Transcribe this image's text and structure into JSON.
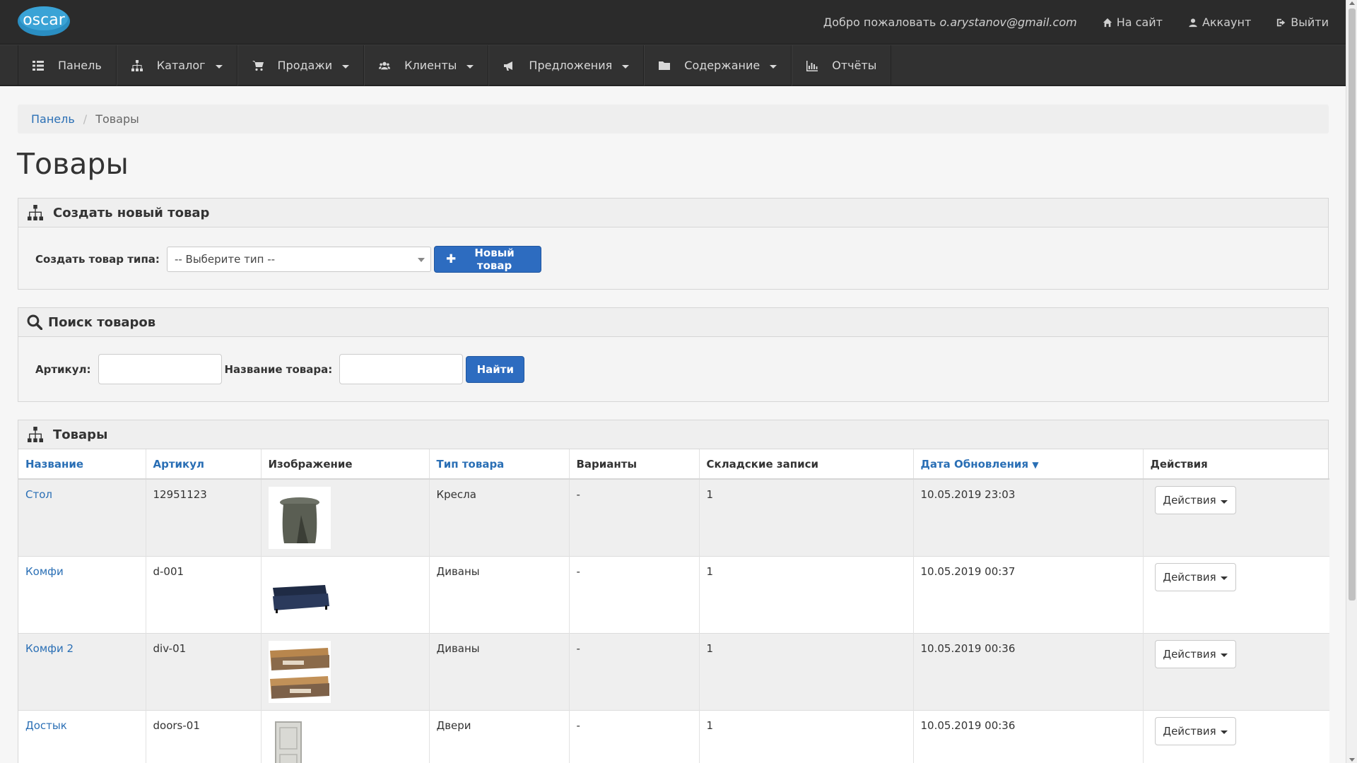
{
  "header": {
    "logo_text": "oscar",
    "welcome_prefix": "Добро пожаловать",
    "user_email": "o.arystanov@gmail.com",
    "site_link": "На сайт",
    "account_link": "Аккаунт",
    "logout_link": "Выйти"
  },
  "nav": {
    "items": [
      {
        "label": "Панель",
        "icon": "dashboard-icon"
      },
      {
        "label": "Каталог",
        "icon": "sitemap-icon"
      },
      {
        "label": "Продажи",
        "icon": "cart-icon"
      },
      {
        "label": "Клиенты",
        "icon": "users-icon"
      },
      {
        "label": "Предложения",
        "icon": "bullhorn-icon"
      },
      {
        "label": "Содержание",
        "icon": "folder-icon"
      },
      {
        "label": "Отчёты",
        "icon": "bar-chart-icon"
      }
    ]
  },
  "breadcrumb": {
    "home": "Панель",
    "current": "Товары"
  },
  "page_title": "Товары",
  "create_panel": {
    "title": "Создать новый товар",
    "label": "Создать товар типа:",
    "select_value": "-- Выберите тип --",
    "button": "Новый товар"
  },
  "search_panel": {
    "title": "Поиск товаров",
    "sku_label": "Артикул:",
    "name_label": "Название товара:",
    "button": "Найти"
  },
  "products_panel": {
    "title": "Товары",
    "columns": [
      "Название",
      "Артикул",
      "Изображение",
      "Тип товара",
      "Варианты",
      "Складские записи",
      "Дата Обновления",
      "Действия"
    ],
    "rows": [
      {
        "name": "Стол",
        "sku": "12951123",
        "type": "Кресла",
        "variants": "-",
        "stock": "1",
        "updated": "10.05.2019 23:03",
        "action": "Действия"
      },
      {
        "name": "Комфи",
        "sku": "d-001",
        "type": "Диваны",
        "variants": "-",
        "stock": "1",
        "updated": "10.05.2019 00:37",
        "action": "Действия"
      },
      {
        "name": "Комфи 2",
        "sku": "div-01",
        "type": "Диваны",
        "variants": "-",
        "stock": "1",
        "updated": "10.05.2019 00:36",
        "action": "Действия"
      },
      {
        "name": "Достык",
        "sku": "doors-01",
        "type": "Двери",
        "variants": "-",
        "stock": "1",
        "updated": "10.05.2019 00:36",
        "action": "Действия"
      }
    ]
  },
  "colors": {
    "accent": "#2d6cc0",
    "link": "#2a6fb5",
    "topbar": "#2b2b2b",
    "navbar": "#313131"
  }
}
